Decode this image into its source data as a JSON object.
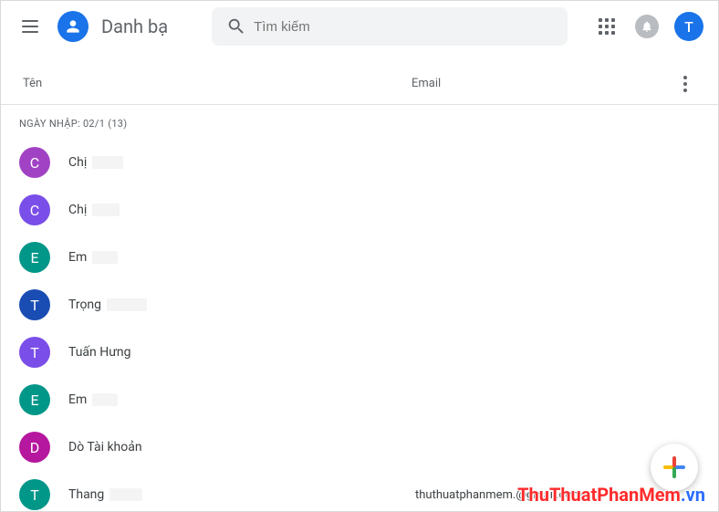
{
  "header": {
    "app_title": "Danh bạ",
    "search_placeholder": "Tìm kiếm",
    "account_letter": "T"
  },
  "columns": {
    "name": "Tên",
    "email": "Email"
  },
  "group": {
    "label": "NGÀY NHẬP: 02/1 (13)"
  },
  "contacts": [
    {
      "letter": "C",
      "name": "Chị",
      "email": "",
      "avatar_bg": "#a142c4",
      "redact_w": 34
    },
    {
      "letter": "C",
      "name": "Chị",
      "email": "",
      "avatar_bg": "#7a4ee8",
      "redact_w": 30
    },
    {
      "letter": "E",
      "name": "Em",
      "email": "",
      "avatar_bg": "#009688",
      "redact_w": 28
    },
    {
      "letter": "T",
      "name": "Trọng",
      "email": "",
      "avatar_bg": "#1a4db3",
      "redact_w": 44
    },
    {
      "letter": "T",
      "name": "Tuấn Hưng",
      "email": "",
      "avatar_bg": "#7a4ee8",
      "redact_w": 0
    },
    {
      "letter": "E",
      "name": "Em",
      "email": "",
      "avatar_bg": "#009688",
      "redact_w": 28
    },
    {
      "letter": "D",
      "name": "Dò Tài khoản",
      "email": "",
      "avatar_bg": "#b5179e",
      "redact_w": 0
    },
    {
      "letter": "T",
      "name": "Thang",
      "email": "thuthuatphanmem.@gmail.com",
      "avatar_bg": "#009688",
      "redact_w": 36
    }
  ],
  "watermark": {
    "main": "ThuThuatPhanMem",
    "suffix": ".vn"
  }
}
